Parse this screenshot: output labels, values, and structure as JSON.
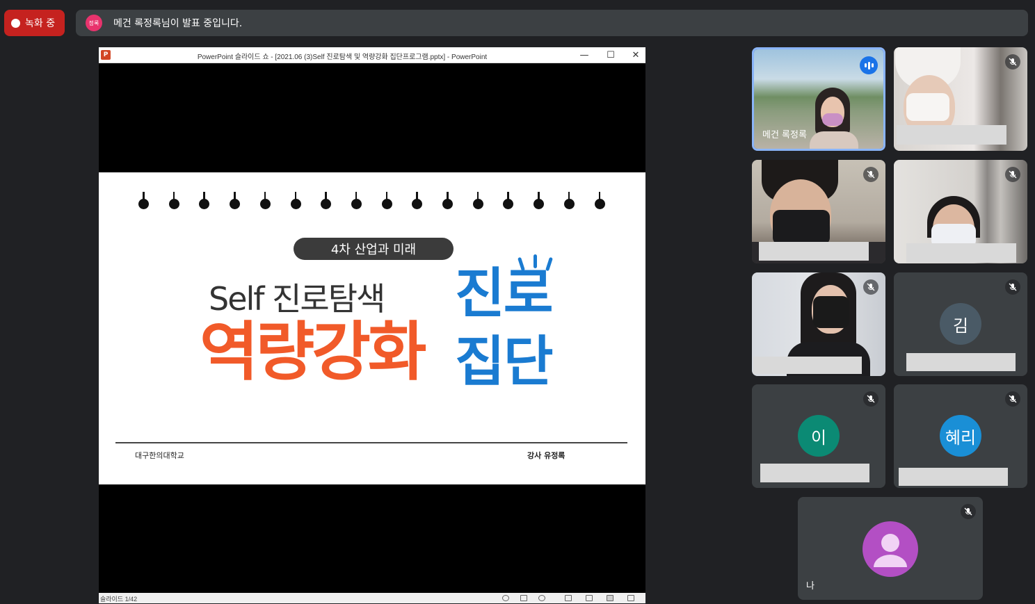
{
  "recording": {
    "label": "녹화 중"
  },
  "presenter_banner": {
    "avatar_initials": "정록",
    "text": "메건 록정록님이 발표 중입니다."
  },
  "powerpoint": {
    "window_title": "PowerPoint 슬라이드 쇼 - [2021.06 (3)Self 진로탐색 및 역량강화 집단프로그램.pptx] - PowerPoint",
    "minimize": "—",
    "maximize": "☐",
    "close": "✕",
    "status_left": "슬라이드 1/42"
  },
  "slide": {
    "chip": "4차 산업과 미래",
    "subtitle": "Self 진로탐색",
    "headline": "역량강화",
    "side_line1": "진로",
    "side_line2": "집단",
    "footer_left": "대구한의대학교",
    "footer_right": "강사   유정록"
  },
  "participants": [
    {
      "name": "메건 록정록",
      "speaking": true
    },
    {
      "name": "",
      "muted": true
    },
    {
      "name": "",
      "muted": true
    },
    {
      "name": "",
      "muted": true
    },
    {
      "name": "",
      "muted": true
    },
    {
      "name": "",
      "muted": true,
      "avatar": "김",
      "avatar_color": "#4a5a66"
    },
    {
      "name": "",
      "muted": true,
      "avatar": "이",
      "avatar_color": "#0b8a74"
    },
    {
      "name": "",
      "muted": true,
      "avatar": "혜리",
      "avatar_color": "#1a8fd6"
    },
    {
      "name": "나",
      "muted": true,
      "avatar_color": "#b34fc4"
    }
  ],
  "colors": {
    "background": "#202124",
    "tile": "#3c4043",
    "record": "#c5221f",
    "speaking_border": "#8ab4f8"
  }
}
